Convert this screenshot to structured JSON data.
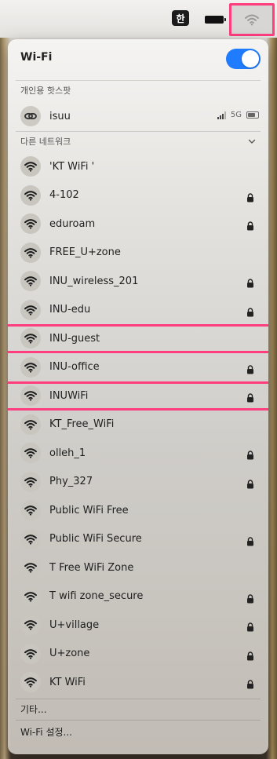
{
  "menubar": {
    "ime_label": "한",
    "wifi_icon": "wifi-icon",
    "battery_icon": "battery-icon"
  },
  "panel": {
    "title": "Wi-Fi",
    "wifi_enabled": true,
    "accent_color": "#1f7cff",
    "highlight_color": "#ff3d7f",
    "personal_hotspot": {
      "section_label": "개인용 핫스팟",
      "name": "isuu",
      "network_type": "5G"
    },
    "other_networks": {
      "section_label": "다른 네트워크",
      "items": [
        {
          "name": "'KT WiFi '",
          "locked": false,
          "highlighted": false
        },
        {
          "name": "4-102",
          "locked": true,
          "highlighted": false
        },
        {
          "name": "eduroam",
          "locked": true,
          "highlighted": false
        },
        {
          "name": "FREE_U+zone",
          "locked": false,
          "highlighted": false
        },
        {
          "name": "INU_wireless_201",
          "locked": true,
          "highlighted": false
        },
        {
          "name": "INU-edu",
          "locked": true,
          "highlighted": false
        },
        {
          "name": "INU-guest",
          "locked": false,
          "highlighted": true
        },
        {
          "name": "INU-office",
          "locked": true,
          "highlighted": false
        },
        {
          "name": "INUWiFi",
          "locked": true,
          "highlighted": true
        },
        {
          "name": "KT_Free_WiFi",
          "locked": false,
          "highlighted": false
        },
        {
          "name": "olleh_1",
          "locked": true,
          "highlighted": false
        },
        {
          "name": "Phy_327",
          "locked": true,
          "highlighted": false
        },
        {
          "name": "Public WiFi Free",
          "locked": false,
          "highlighted": false
        },
        {
          "name": "Public WiFi Secure",
          "locked": true,
          "highlighted": false
        },
        {
          "name": "T Free WiFi Zone",
          "locked": false,
          "highlighted": false
        },
        {
          "name": "T wifi zone_secure",
          "locked": true,
          "highlighted": false
        },
        {
          "name": "U+village",
          "locked": true,
          "highlighted": false
        },
        {
          "name": "U+zone",
          "locked": true,
          "highlighted": false
        },
        {
          "name": "KT WiFi",
          "locked": true,
          "highlighted": false
        }
      ]
    },
    "other_label": "기타...",
    "settings_label": "Wi-Fi 설정..."
  }
}
